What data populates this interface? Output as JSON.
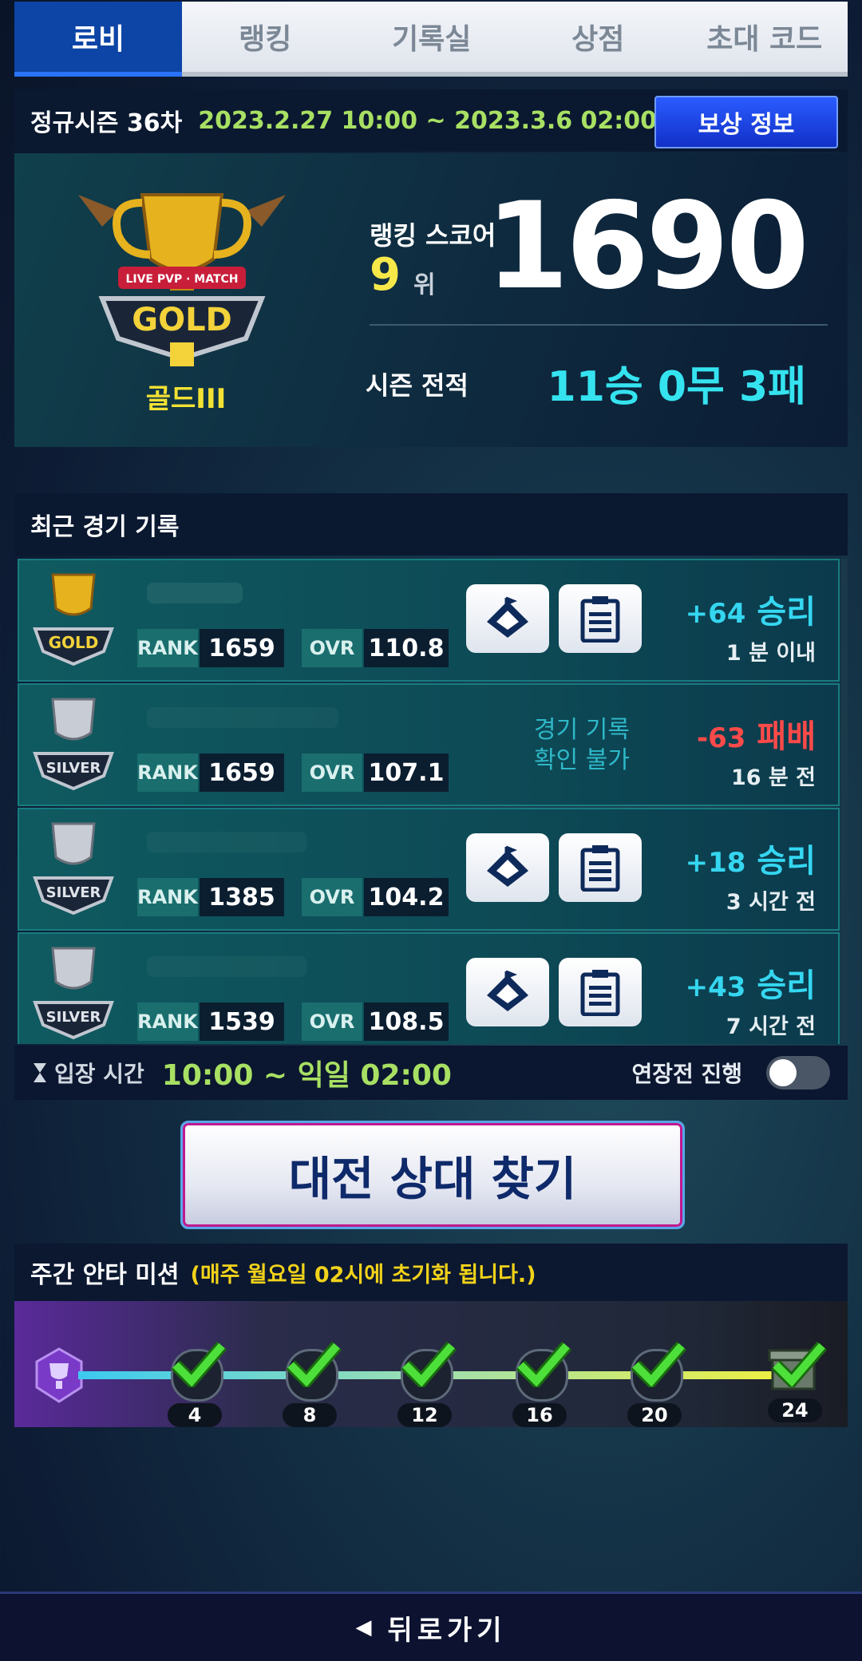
{
  "tabs": [
    {
      "label": "로비"
    },
    {
      "label": "랭킹"
    },
    {
      "label": "기록실"
    },
    {
      "label": "상점"
    },
    {
      "label": "초대 코드"
    }
  ],
  "season": {
    "title": "정규시즌 36차",
    "dates": "2023.2.27 10:00 ~ 2023.3.6 02:00",
    "reward_button": "보상 정보"
  },
  "profile": {
    "tier_badge_text": "GOLD",
    "tier_badge_small": "LIVE PVP · MATCH",
    "tier_name": "골드III",
    "score_label": "랭킹 스코어",
    "rank": "9",
    "rank_unit": "위",
    "score": "1690",
    "record_label": "시즌 전적",
    "record": "11승 0무 3패"
  },
  "recent": {
    "title": "최근 경기 기록",
    "matches": [
      {
        "tier": "GOLD",
        "rank_label": "RANK",
        "rank": "1659",
        "ovr_label": "OVR",
        "ovr": "110.8",
        "points": "+64",
        "result": "승리",
        "time": "1 분 이내",
        "has_buttons": true
      },
      {
        "tier": "SILVER",
        "rank_label": "RANK",
        "rank": "1659",
        "ovr_label": "OVR",
        "ovr": "107.1",
        "points": "-63",
        "result": "패배",
        "time": "16 분 전",
        "unavailable": "경기 기록\n확인 불가"
      },
      {
        "tier": "SILVER",
        "rank_label": "RANK",
        "rank": "1385",
        "ovr_label": "OVR",
        "ovr": "104.2",
        "points": "+18",
        "result": "승리",
        "time": "3 시간 전",
        "has_buttons": true
      },
      {
        "tier": "SILVER",
        "rank_label": "RANK",
        "rank": "1539",
        "ovr_label": "OVR",
        "ovr": "108.5",
        "points": "+43",
        "result": "승리",
        "time": "7 시간 전",
        "has_buttons": true
      }
    ]
  },
  "entry": {
    "label": "입장 시간",
    "time": "10:00 ~ 익일 02:00",
    "overtime_label": "연장전 진행",
    "overtime_on": false
  },
  "find_button": "대전 상대 찾기",
  "mission": {
    "title": "주간 안타 미션",
    "note": "(매주 월요일 02시에 초기화 됩니다.)",
    "steps": [
      "4",
      "8",
      "12",
      "16",
      "20",
      "24"
    ]
  },
  "back_button": "뒤로가기",
  "colors": {
    "win": "#35d6f0",
    "loss": "#ff4a4a",
    "accent_green": "#a8e063",
    "gold_text": "#f3e233"
  }
}
